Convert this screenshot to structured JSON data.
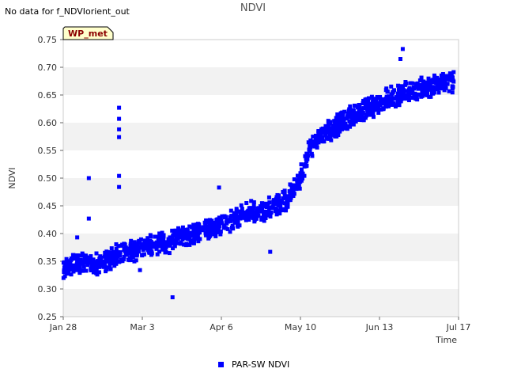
{
  "notice": "No data for f_NDVIorient_out",
  "tag_label": "WP_met",
  "chart_data": {
    "type": "scatter",
    "title": "NDVI",
    "xlabel": "Time",
    "ylabel": "NDVI",
    "x_ticks": [
      "Jan 28",
      "Mar 3",
      "Apr 6",
      "May 10",
      "Jun 13",
      "Jul 17"
    ],
    "x_range": [
      "Jan 28",
      "Jul 17"
    ],
    "ylim": [
      0.25,
      0.75
    ],
    "y_ticks": [
      "0.25",
      "0.30",
      "0.35",
      "0.40",
      "0.45",
      "0.50",
      "0.55",
      "0.60",
      "0.65",
      "0.70",
      "0.75"
    ],
    "grid": "horizontal alternating bands",
    "legend_position": "bottom-center",
    "colors": {
      "series": "#0000ff",
      "band": "#f2f2f2",
      "tag_fill": "#ffffcc",
      "tag_text": "#8b0000"
    },
    "series": [
      {
        "name": "PAR-SW NDVI",
        "color": "#0000ff",
        "trend_anchors": [
          [
            "Jan 28",
            0.34
          ],
          [
            "Feb 7",
            0.35
          ],
          [
            "Feb 12",
            0.345
          ],
          [
            "Feb 20",
            0.36
          ],
          [
            "Mar 3",
            0.375
          ],
          [
            "Mar 15",
            0.385
          ],
          [
            "Mar 20",
            0.395
          ],
          [
            "Apr 6",
            0.415
          ],
          [
            "Apr 16",
            0.435
          ],
          [
            "Apr 26",
            0.445
          ],
          [
            "May 4",
            0.46
          ],
          [
            "May 10",
            0.5
          ],
          [
            "May 14",
            0.555
          ],
          [
            "May 20",
            0.58
          ],
          [
            "May 26",
            0.595
          ],
          [
            "Jun 2",
            0.615
          ],
          [
            "Jun 10",
            0.63
          ],
          [
            "Jun 20",
            0.65
          ],
          [
            "Jun 30",
            0.66
          ],
          [
            "Jul 10",
            0.67
          ],
          [
            "Jul 15",
            0.675
          ]
        ],
        "spread": 0.022,
        "approx_point_count": 1500,
        "outliers": [
          [
            "Feb 8",
            0.5
          ],
          [
            "Feb 8",
            0.427
          ],
          [
            "Feb 3",
            0.393
          ],
          [
            "Feb 21",
            0.627
          ],
          [
            "Feb 21",
            0.607
          ],
          [
            "Feb 21",
            0.588
          ],
          [
            "Feb 21",
            0.574
          ],
          [
            "Feb 21",
            0.504
          ],
          [
            "Feb 21",
            0.484
          ],
          [
            "Mar 16",
            0.285
          ],
          [
            "Apr 5",
            0.483
          ],
          [
            "Apr 27",
            0.367
          ],
          [
            "Jun 23",
            0.733
          ],
          [
            "Jun 22",
            0.715
          ],
          [
            "Mar 2",
            0.334
          ]
        ]
      }
    ]
  }
}
